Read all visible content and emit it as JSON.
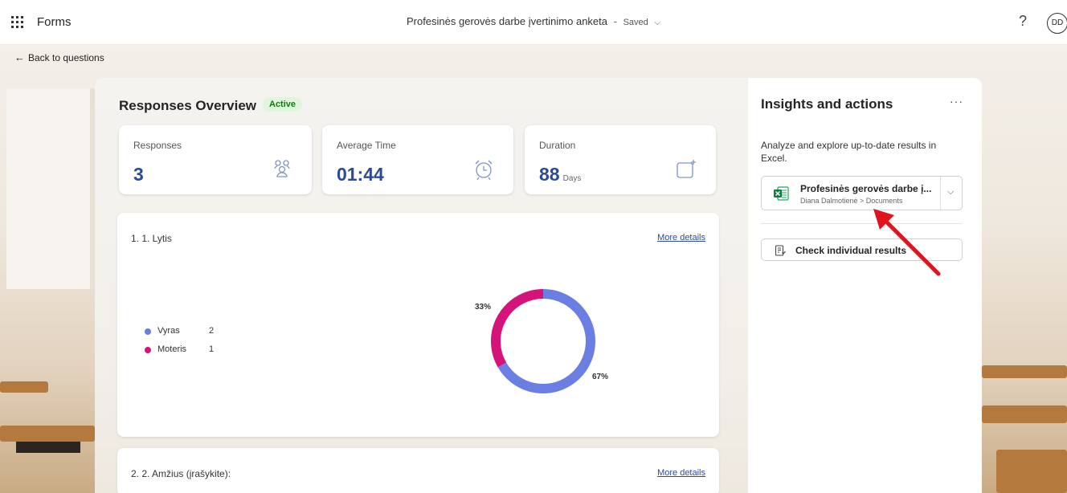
{
  "app": {
    "name": "Forms",
    "document_title": "Profesinės gerovės darbe įvertinimo anketa",
    "title_separator": "-",
    "save_status": "Saved",
    "avatar_initials": "DD",
    "help_label": "?"
  },
  "nav": {
    "back_label": "Back to questions"
  },
  "overview": {
    "title": "Responses Overview",
    "status_badge": "Active",
    "stats": [
      {
        "label": "Responses",
        "value": "3",
        "unit": "",
        "icon": "people-icon"
      },
      {
        "label": "Average Time",
        "value": "01:44",
        "unit": "",
        "icon": "alarm-clock-icon"
      },
      {
        "label": "Duration",
        "value": "88",
        "unit": "Days",
        "icon": "calendar-sparkle-icon"
      }
    ]
  },
  "questions": [
    {
      "title": "1. 1. Lytis",
      "more_label": "More details",
      "legend": [
        {
          "label": "Vyras",
          "count": "2",
          "color": "#6b7fe3"
        },
        {
          "label": "Moteris",
          "count": "1",
          "color": "#d4147a"
        }
      ],
      "chart_data": {
        "type": "pie",
        "categories": [
          "Vyras",
          "Moteris"
        ],
        "values": [
          2,
          1
        ],
        "percent_labels": [
          "67%",
          "33%"
        ],
        "colors": [
          "#6b7fe3",
          "#d4147a"
        ]
      }
    },
    {
      "title": "2. 2. Amžius (įrašykite):",
      "more_label": "More details"
    }
  ],
  "insights": {
    "title": "Insights and actions",
    "more_label": "···",
    "description": "Analyze and explore up-to-date results in Excel.",
    "file_name": "Profesinės gerovės darbe į...",
    "file_path": "Diana Dalmotienė > Documents",
    "check_label": "Check individual results"
  },
  "colors": {
    "accent_blue": "#2b4b9a",
    "active_green": "#107c10",
    "annotation_red": "#e0141e"
  }
}
